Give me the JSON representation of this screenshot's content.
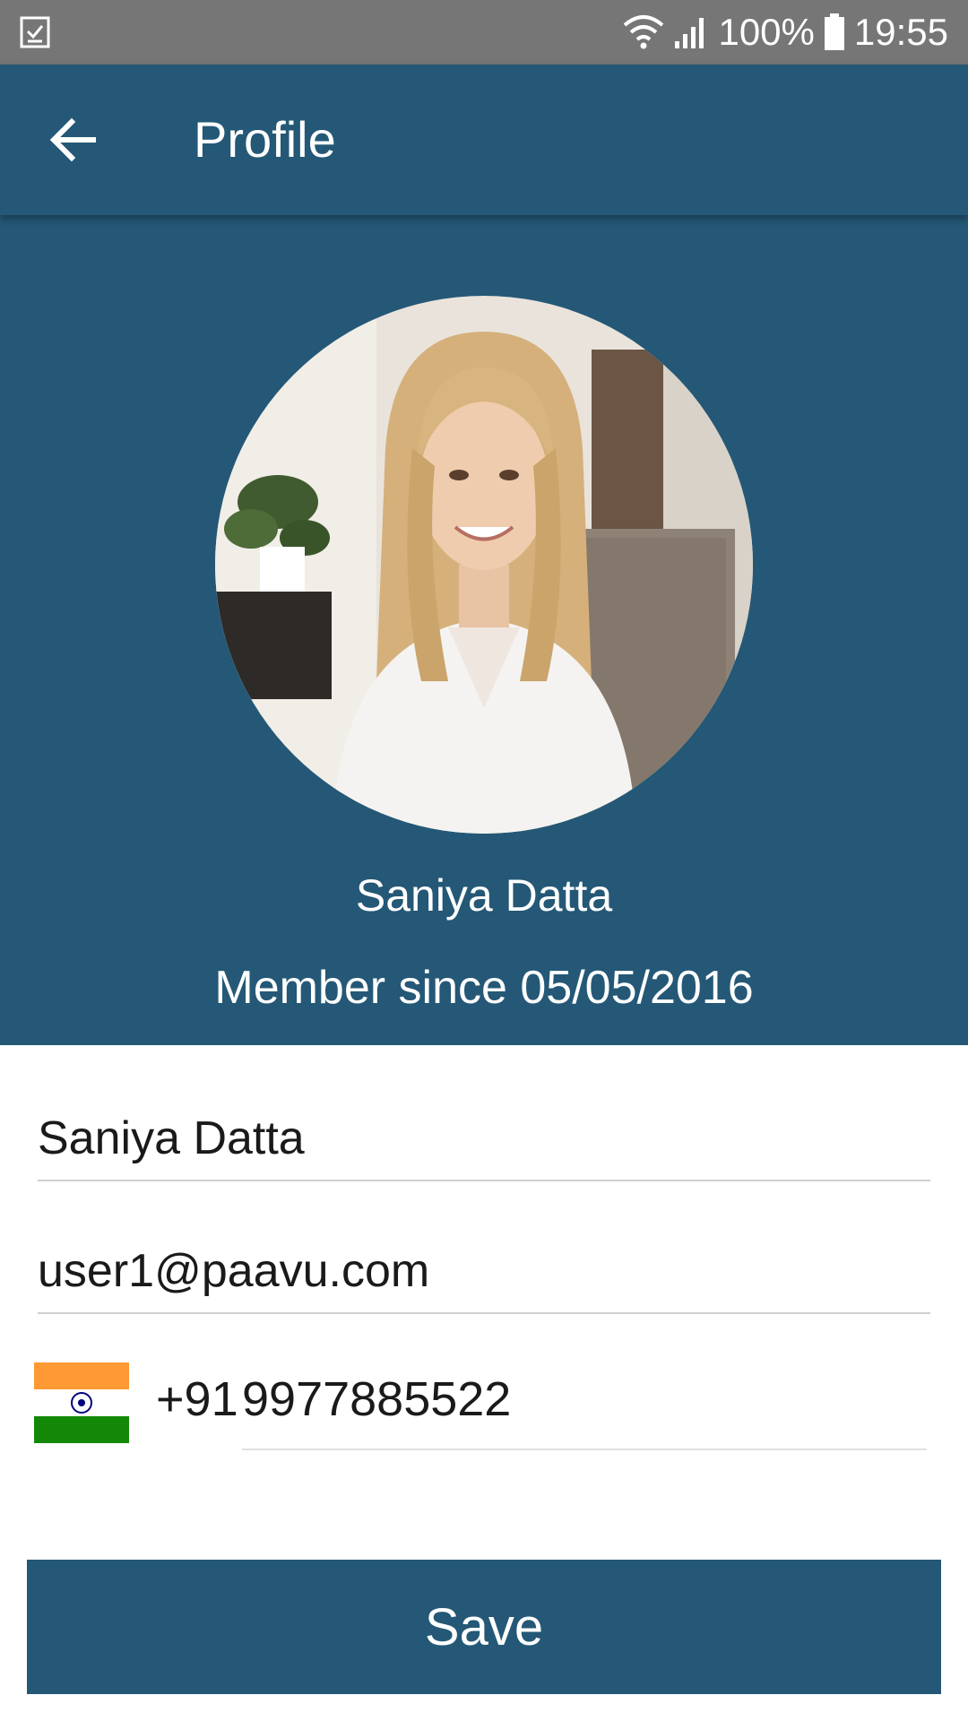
{
  "status_bar": {
    "left_icon": "task-check-icon",
    "wifi_icon": "wifi-icon",
    "signal_icon": "cell-signal-icon",
    "battery_percent": "100%",
    "battery_icon": "battery-icon",
    "time": "19:55"
  },
  "app_bar": {
    "back_icon": "arrow-back-icon",
    "title": "Profile",
    "color": "#245876"
  },
  "profile": {
    "display_name": "Saniya Datta",
    "member_since": "Member since 05/05/2016",
    "avatar": "profile-photo"
  },
  "form": {
    "name_value": "Saniya Datta",
    "email_value": "user1@paavu.com",
    "country_flag": "india-flag-icon",
    "country_code": "+91",
    "phone_value": "9977885522"
  },
  "actions": {
    "save_label": "Save"
  }
}
